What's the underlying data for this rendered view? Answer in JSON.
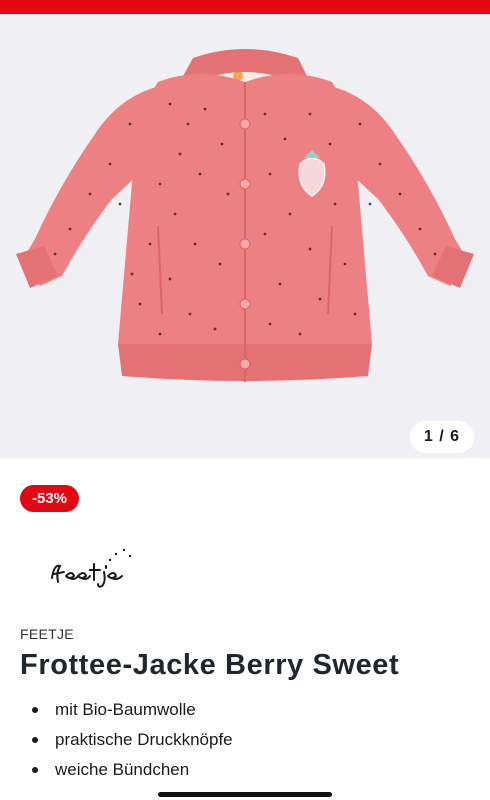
{
  "colors": {
    "brand_red": "#e30613",
    "gallery_background": "#efeff4",
    "jacket_pink": "#ec8083",
    "rib_pink": "#e47174",
    "dots": "#4a2020"
  },
  "gallery": {
    "image_icon": "pink-dotted-jacket-image",
    "counter": "1 / 6"
  },
  "discount_badge": "-53%",
  "brand": {
    "logo_icon": "feetje-logo",
    "name": "FEETJE"
  },
  "product": {
    "title": "Frottee-Jacke Berry Sweet",
    "features": [
      "mit Bio-Baumwolle",
      "praktische Druckknöpfe",
      "weiche Bündchen"
    ]
  }
}
